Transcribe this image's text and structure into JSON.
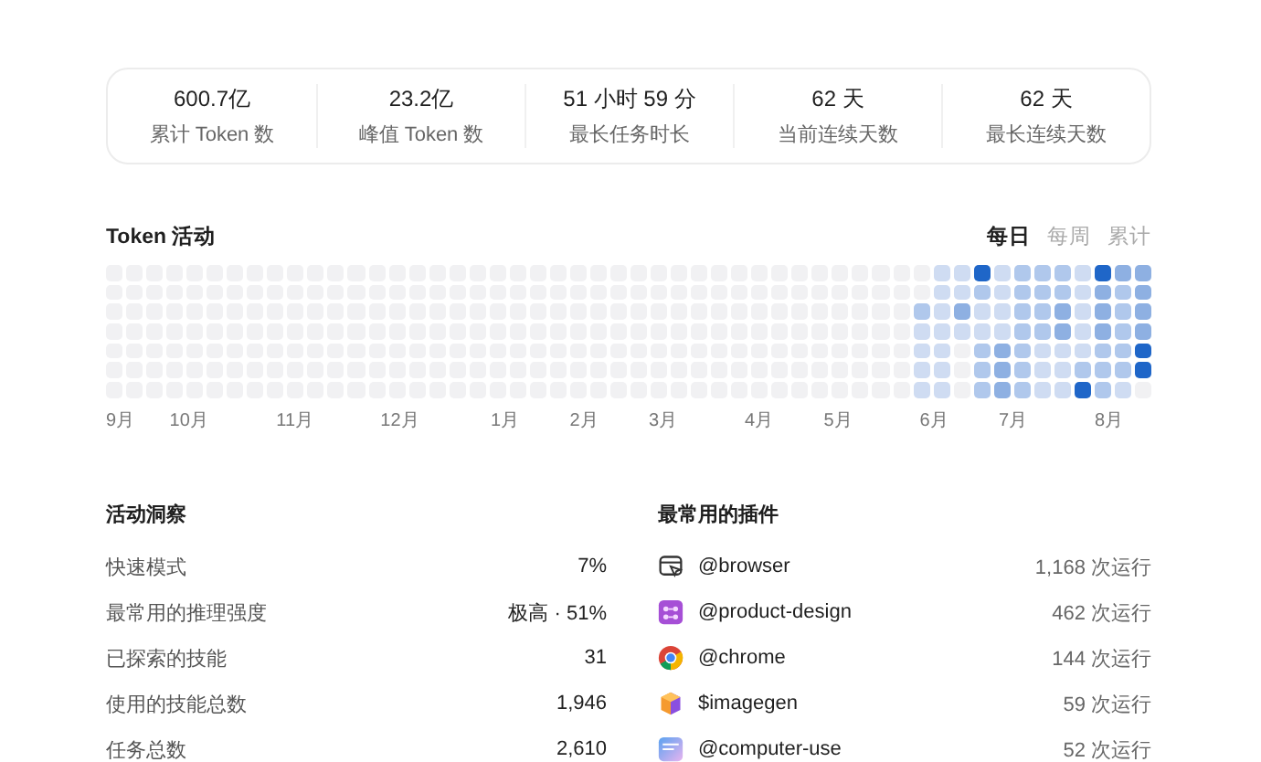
{
  "stats": [
    {
      "value": "600.7亿",
      "label": "累计 Token 数"
    },
    {
      "value": "23.2亿",
      "label": "峰值 Token 数"
    },
    {
      "value": "51 小时 59 分",
      "label": "最长任务时长"
    },
    {
      "value": "62 天",
      "label": "当前连续天数"
    },
    {
      "value": "62 天",
      "label": "最长连续天数"
    }
  ],
  "activity": {
    "title": "Token 活动",
    "tabs": [
      {
        "label": "每日",
        "selected": true
      },
      {
        "label": "每周",
        "selected": false
      },
      {
        "label": "累计",
        "selected": false
      }
    ],
    "months": [
      "9月",
      "10月",
      "11月",
      "12月",
      "1月",
      "2月",
      "3月",
      "4月",
      "5月",
      "6月",
      "7月",
      "8月"
    ]
  },
  "insights": {
    "title": "活动洞察",
    "rows": [
      {
        "label": "快速模式",
        "value": "7%"
      },
      {
        "label": "最常用的推理强度",
        "value": "极高 · 51%"
      },
      {
        "label": "已探索的技能",
        "value": "31"
      },
      {
        "label": "使用的技能总数",
        "value": "1,946"
      },
      {
        "label": "任务总数",
        "value": "2,610"
      }
    ]
  },
  "plugins": {
    "title": "最常用的插件",
    "rows": [
      {
        "kind": "window",
        "name": "@browser",
        "runs": "1,168 次运行"
      },
      {
        "kind": "grid",
        "name": "@product-design",
        "runs": "462 次运行"
      },
      {
        "kind": "globe",
        "name": "@chrome",
        "runs": "144 次运行"
      },
      {
        "kind": "cube",
        "name": "$imagegen",
        "runs": "59 次运行"
      },
      {
        "kind": "screen",
        "name": "@computer-use",
        "runs": "52 次运行"
      }
    ]
  }
}
